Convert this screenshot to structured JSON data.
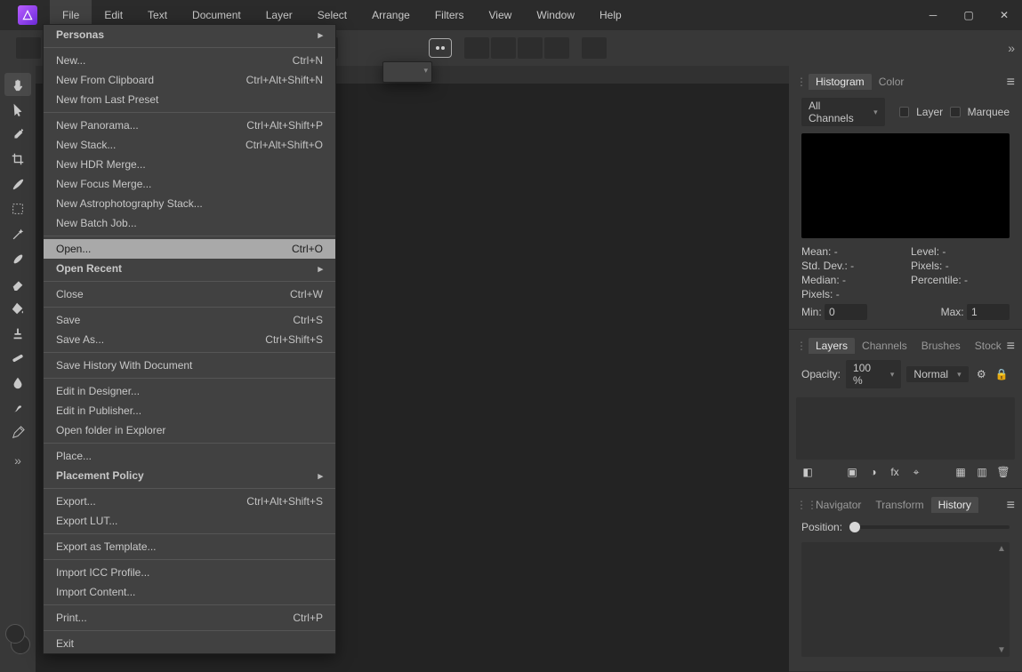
{
  "menubar": [
    "File",
    "Edit",
    "Text",
    "Document",
    "Layer",
    "Select",
    "Arrange",
    "Filters",
    "View",
    "Window",
    "Help"
  ],
  "active_menu_index": 0,
  "file_menu": [
    {
      "label": "Personas",
      "bold": true,
      "sub": true
    },
    {
      "sep": true
    },
    {
      "label": "New...",
      "sc": "Ctrl+N"
    },
    {
      "label": "New From Clipboard",
      "sc": "Ctrl+Alt+Shift+N"
    },
    {
      "label": "New from Last Preset"
    },
    {
      "sep": true
    },
    {
      "label": "New Panorama...",
      "sc": "Ctrl+Alt+Shift+P"
    },
    {
      "label": "New Stack...",
      "sc": "Ctrl+Alt+Shift+O"
    },
    {
      "label": "New HDR Merge..."
    },
    {
      "label": "New Focus Merge..."
    },
    {
      "label": "New Astrophotography Stack..."
    },
    {
      "label": "New Batch Job..."
    },
    {
      "sep": true
    },
    {
      "label": "Open...",
      "sc": "Ctrl+O",
      "hover": true
    },
    {
      "label": "Open Recent",
      "bold": true,
      "sub": true
    },
    {
      "sep": true
    },
    {
      "label": "Close",
      "sc": "Ctrl+W",
      "disabled": true
    },
    {
      "sep": true
    },
    {
      "label": "Save",
      "sc": "Ctrl+S",
      "disabled": true
    },
    {
      "label": "Save As...",
      "sc": "Ctrl+Shift+S",
      "disabled": true
    },
    {
      "sep": true
    },
    {
      "label": "Save History With Document",
      "disabled": true
    },
    {
      "sep": true
    },
    {
      "label": "Edit in Designer...",
      "disabled": true
    },
    {
      "label": "Edit in Publisher...",
      "disabled": true
    },
    {
      "label": "Open folder in Explorer",
      "disabled": true
    },
    {
      "sep": true
    },
    {
      "label": "Place...",
      "disabled": true
    },
    {
      "label": "Placement Policy",
      "bold": true,
      "sub": true
    },
    {
      "sep": true
    },
    {
      "label": "Export...",
      "sc": "Ctrl+Alt+Shift+S",
      "disabled": true
    },
    {
      "label": "Export LUT...",
      "disabled": true
    },
    {
      "sep": true
    },
    {
      "label": "Export as Template...",
      "disabled": true
    },
    {
      "sep": true
    },
    {
      "label": "Import ICC Profile..."
    },
    {
      "label": "Import Content..."
    },
    {
      "sep": true
    },
    {
      "label": "Print...",
      "sc": "Ctrl+P",
      "disabled": true
    },
    {
      "sep": true
    },
    {
      "label": "Exit"
    }
  ],
  "left_tools": [
    {
      "name": "view-tool-icon",
      "active": true,
      "glyph": "hand"
    },
    {
      "name": "move-tool-icon",
      "glyph": "cursor"
    },
    {
      "name": "color-picker-icon",
      "glyph": "dropper"
    },
    {
      "name": "crop-tool-icon",
      "glyph": "crop"
    },
    {
      "name": "selection-brush-icon",
      "glyph": "brush"
    },
    {
      "name": "marquee-tool-icon",
      "glyph": "marquee"
    },
    {
      "name": "flood-select-icon",
      "glyph": "wand"
    },
    {
      "name": "paint-brush-icon",
      "glyph": "paint"
    },
    {
      "name": "erase-tool-icon",
      "glyph": "erase"
    },
    {
      "name": "fill-tool-icon",
      "glyph": "bucket"
    },
    {
      "name": "clone-tool-icon",
      "glyph": "stamp"
    },
    {
      "name": "healing-brush-icon",
      "glyph": "bandage"
    },
    {
      "name": "dodge-tool-icon",
      "glyph": "drop"
    },
    {
      "name": "blur-tool-icon",
      "glyph": "smudge"
    },
    {
      "name": "pen-tool-icon",
      "glyph": "pen"
    }
  ],
  "panels": {
    "hist": {
      "tabs": [
        "Histogram",
        "Color"
      ],
      "active": 0,
      "channel": "All Channels",
      "layer_label": "Layer",
      "marquee_label": "Marquee"
    },
    "stats": {
      "mean": "Mean:",
      "mean_v": "-",
      "std": "Std. Dev.:",
      "std_v": "-",
      "median": "Median:",
      "median_v": "-",
      "pixels": "Pixels:",
      "pixels_v": "-",
      "level": "Level:",
      "level_v": "-",
      "pixels2": "Pixels:",
      "pixels2_v": "-",
      "perc": "Percentile:",
      "perc_v": "-"
    },
    "minmax": {
      "min_label": "Min:",
      "min": "0",
      "max_label": "Max:",
      "max": "1"
    },
    "layers": {
      "tabs": [
        "Layers",
        "Channels",
        "Brushes",
        "Stock"
      ],
      "active": 0,
      "opacity_label": "Opacity:",
      "opacity": "100 %",
      "blend": "Normal"
    },
    "nav": {
      "tabs": [
        "Navigator",
        "Transform",
        "History"
      ],
      "active": 2,
      "pos_label": "Position:"
    }
  }
}
